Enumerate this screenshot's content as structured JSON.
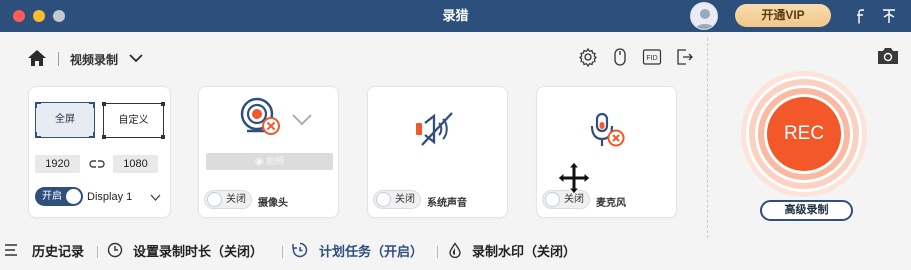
{
  "window": {
    "title": "录猎"
  },
  "header": {
    "vip_label": "开通VIP",
    "icons": [
      "user-avatar",
      "facebook-icon",
      "pin-icon"
    ]
  },
  "toolbar": {
    "mode_label": "视频录制",
    "icons": [
      "home-icon",
      "settings-icon",
      "mouse-icon",
      "fid-icon",
      "export-icon",
      "camera-icon"
    ],
    "fid_text": "FID"
  },
  "cards": {
    "area": {
      "fullscreen": "全屏",
      "custom": "自定义",
      "width": "1920",
      "height": "1080",
      "toggle_label": "开启",
      "display": "Display 1"
    },
    "webcam": {
      "photo_label": "拍照",
      "toggle_label": "关闭",
      "title": "摄像头"
    },
    "system_audio": {
      "toggle_label": "关闭",
      "title": "系统声音"
    },
    "microphone": {
      "toggle_label": "关闭",
      "title": "麦克风"
    }
  },
  "rec": {
    "label": "REC",
    "advanced_label": "高级录制"
  },
  "bottom": {
    "history": "历史记录",
    "duration": "设置录制时长（关闭）",
    "schedule": "计划任务（开启）",
    "watermark": "录制水印（关闭）"
  },
  "colors": {
    "titlebar": "#2c4f7c",
    "accent": "#2f4f7d",
    "rec": "#f3582a",
    "vip": "#f4d09a"
  }
}
